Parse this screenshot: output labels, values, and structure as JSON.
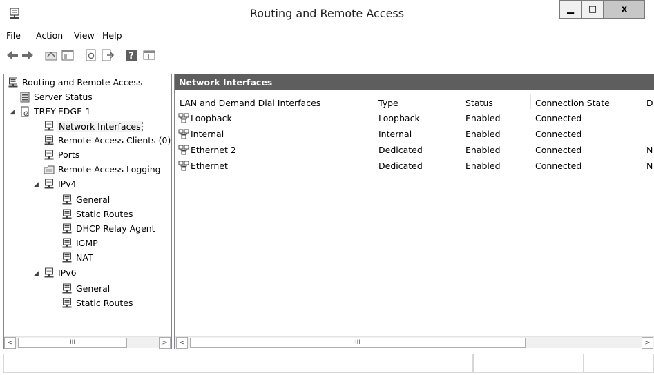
{
  "window": {
    "title": "Routing and Remote Access",
    "minimize_glyph": "▁",
    "maximize_glyph": "□",
    "close_glyph": "x"
  },
  "menu": [
    "File",
    "Action",
    "View",
    "Help"
  ],
  "toolbar": {
    "icons": [
      "back-arrow-icon",
      "forward-arrow-icon",
      "up-folder-icon",
      "show-hide-tree-icon",
      "refresh-icon",
      "export-list-icon",
      "help-icon",
      "properties-icon"
    ]
  },
  "tree": {
    "root": "Routing and Remote Access",
    "server_status": "Server Status",
    "server": "TREY-EDGE-1",
    "network_interfaces": "Network Interfaces",
    "remote_access_clients": "Remote Access Clients (0)",
    "ports": "Ports",
    "remote_access_logging": "Remote Access Logging",
    "ipv4": "IPv4",
    "ipv4_children": [
      "General",
      "Static Routes",
      "DHCP Relay Agent",
      "IGMP",
      "NAT"
    ],
    "ipv6": "IPv6",
    "ipv6_children": [
      "General",
      "Static Routes"
    ]
  },
  "details": {
    "header": "Network Interfaces",
    "columns": [
      "LAN and Demand Dial Interfaces",
      "Type",
      "Status",
      "Connection State",
      "D"
    ],
    "rows": [
      {
        "name": "Loopback",
        "type": "Loopback",
        "status": "Enabled",
        "state": "Connected",
        "extra": ""
      },
      {
        "name": "Internal",
        "type": "Internal",
        "status": "Enabled",
        "state": "Connected",
        "extra": ""
      },
      {
        "name": "Ethernet 2",
        "type": "Dedicated",
        "status": "Enabled",
        "state": "Connected",
        "extra": "N"
      },
      {
        "name": "Ethernet",
        "type": "Dedicated",
        "status": "Enabled",
        "state": "Connected",
        "extra": "N"
      }
    ]
  },
  "scroll": {
    "left_thumb_glyph": "III",
    "right_thumb_glyph": "III",
    "left_arrow": "<",
    "right_arrow": ">"
  },
  "colors": {
    "pane_header_bg": "#5e5e5e",
    "pane_header_text": "#ffffff"
  }
}
